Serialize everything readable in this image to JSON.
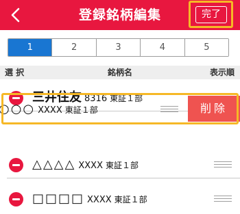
{
  "header": {
    "title": "登録銘柄編集",
    "done_label": "完了"
  },
  "pager": {
    "pages": [
      "1",
      "2",
      "3",
      "4",
      "5"
    ],
    "active": "1"
  },
  "columns": {
    "select": "選 択",
    "name": "銘柄名",
    "order": "表示順"
  },
  "rows": [
    {
      "name": "三井住友",
      "code": "8316",
      "market": "東証１部"
    },
    {
      "name": "○○○",
      "code": "XXXX",
      "market": "東証１部",
      "delete_label": "削除"
    },
    {
      "name": "△△△△",
      "code": "XXXX",
      "market": "東証１部"
    },
    {
      "name": "□□□□",
      "code": "XXXX",
      "market": "東証１部"
    }
  ],
  "colors": {
    "header": "#e8173f",
    "active_page": "#1976d2",
    "delete": "#ef5350",
    "highlight": "#f6b826"
  },
  "icons": {
    "back": "chevron-left-icon",
    "remove": "minus-circle-icon",
    "reorder": "drag-handle-icon"
  }
}
